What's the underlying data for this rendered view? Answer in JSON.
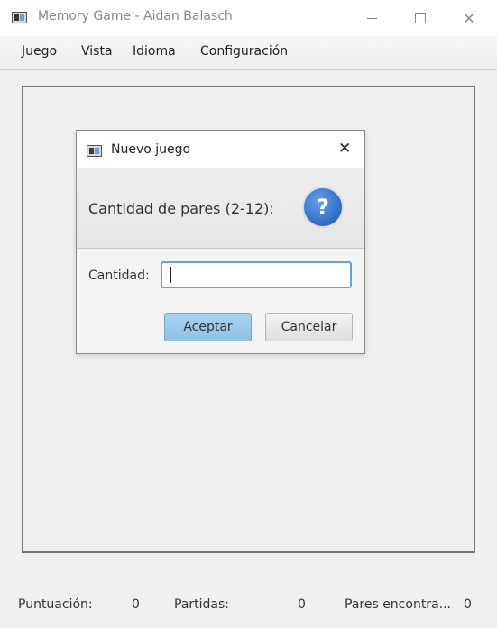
{
  "window": {
    "title": "Memory Game - Aidan Balasch"
  },
  "menu": {
    "items": [
      "Juego",
      "Vista",
      "Idioma",
      "Configuración"
    ]
  },
  "status": {
    "score_label": "Puntuación:",
    "score_value": "0",
    "games_label": "Partidas:",
    "games_value": "0",
    "pairs_label": "Pares encontra...",
    "pairs_value": "0"
  },
  "dialog": {
    "title": "Nuevo juego",
    "question": "Cantidad de pares (2-12):",
    "field_label": "Cantidad:",
    "field_value": "",
    "ok_label": "Aceptar",
    "cancel_label": "Cancelar",
    "help_symbol": "?",
    "close_symbol": "✕"
  },
  "colors": {
    "accent": "#5aa7e0",
    "help_icon": "#2f6bc5",
    "ok_button": "#9fcaeb"
  }
}
